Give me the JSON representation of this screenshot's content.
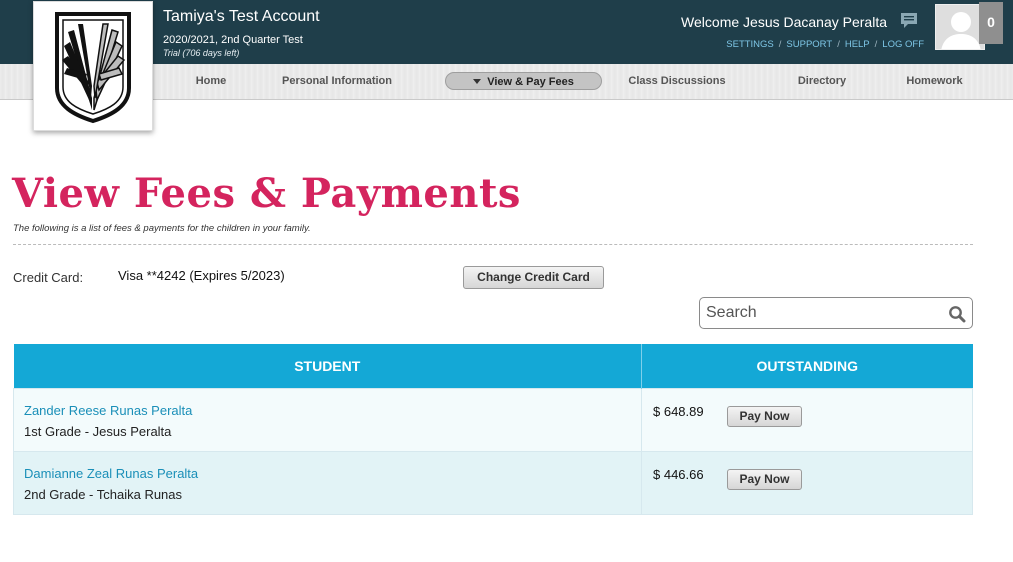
{
  "header": {
    "account_name": "Tamiya's Test Account",
    "term": "2020/2021, 2nd Quarter Test",
    "trial": "Trial (706 days left)",
    "welcome": "Welcome Jesus Dacanay Peralta",
    "links": [
      "SETTINGS",
      "SUPPORT",
      "HELP",
      "LOG OFF"
    ],
    "notification_count": "0"
  },
  "nav": {
    "items": [
      "Home",
      "Personal Information",
      "View & Pay Fees",
      "Class Discussions",
      "Directory",
      "Homework"
    ],
    "active": "View & Pay Fees"
  },
  "main": {
    "title": "View Fees & Payments",
    "subtitle": "The following is a list of fees & payments for the children in your family.",
    "credit_card": {
      "label": "Credit Card:",
      "value": "Visa **4242 (Expires 5/2023)",
      "button": "Change Credit Card"
    },
    "search": {
      "placeholder": "Search"
    },
    "table": {
      "headers": [
        "STUDENT",
        "OUTSTANDING"
      ],
      "rows": [
        {
          "name": "Zander Reese Runas Peralta",
          "info": "1st Grade - Jesus Peralta",
          "amount": "$ 648.89",
          "button": "Pay Now"
        },
        {
          "name": "Damianne Zeal Runas Peralta",
          "info": "2nd Grade - Tchaika Runas",
          "amount": "$ 446.66",
          "button": "Pay Now"
        }
      ]
    }
  },
  "colors": {
    "header_bg": "#1f3e4a",
    "title": "#d4245e",
    "table_header": "#14a8d6",
    "link": "#1a8fb8"
  },
  "icons": [
    "chat-bubble-icon",
    "user-silhouette-icon",
    "search-icon",
    "wings-of-freedom-logo"
  ]
}
